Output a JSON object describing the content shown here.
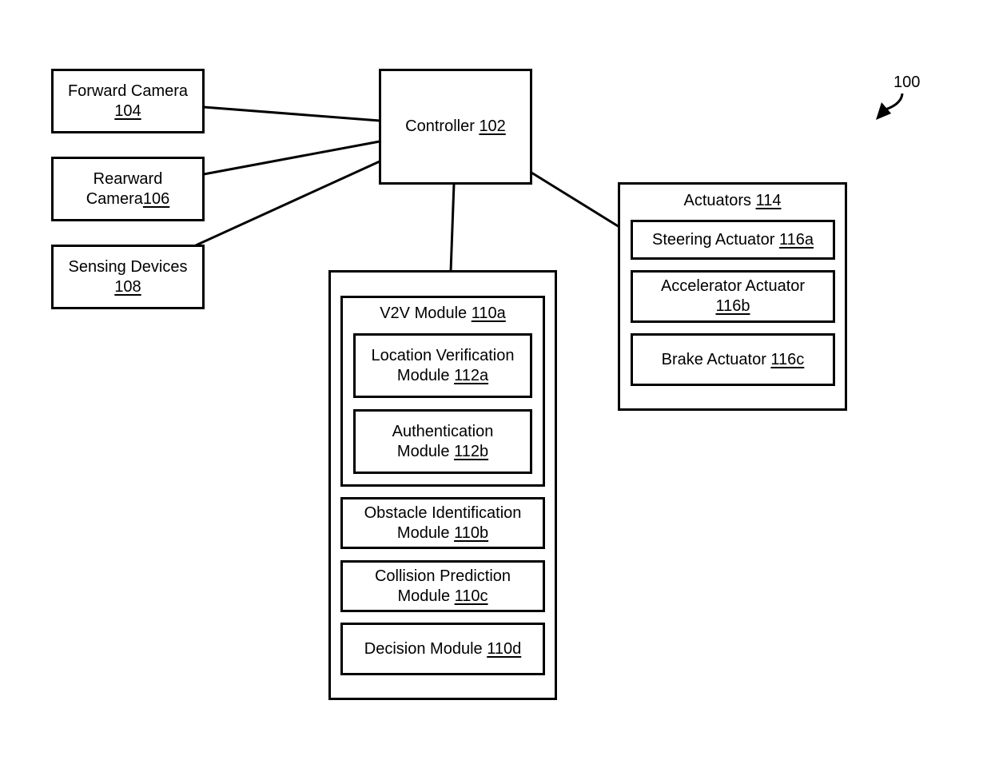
{
  "figure": {
    "reference": "100",
    "arrow_icon": "curved-arrow"
  },
  "controller": {
    "label": "Controller",
    "ref": "102"
  },
  "inputs": [
    {
      "line1": "Forward Camera",
      "line2": "",
      "ref": "104"
    },
    {
      "line1": "Rearward",
      "line2": "Camera",
      "ref": "106"
    },
    {
      "line1": "Sensing Devices",
      "line2": "",
      "ref": "108"
    }
  ],
  "modules": {
    "v2v": {
      "label": "V2V Module",
      "ref": "110a",
      "children": [
        {
          "line1": "Location Verification",
          "line2": "Module",
          "ref": "112a"
        },
        {
          "line1": "Authentication",
          "line2": "Module",
          "ref": "112b"
        }
      ]
    },
    "others": [
      {
        "line1": "Obstacle Identification",
        "line2": "Module",
        "ref": "110b"
      },
      {
        "line1": "Collision Prediction",
        "line2": "Module",
        "ref": "110c"
      },
      {
        "line1": "Decision Module",
        "line2": "",
        "ref": "110d"
      }
    ]
  },
  "actuators": {
    "label": "Actuators",
    "ref": "114",
    "items": [
      {
        "line1": "Steering Actuator",
        "ref": "116a",
        "inline": true
      },
      {
        "line1": "Accelerator Actuator",
        "ref": "116b",
        "inline": false
      },
      {
        "line1": "Brake Actuator",
        "ref": "116c",
        "inline": true
      }
    ]
  }
}
